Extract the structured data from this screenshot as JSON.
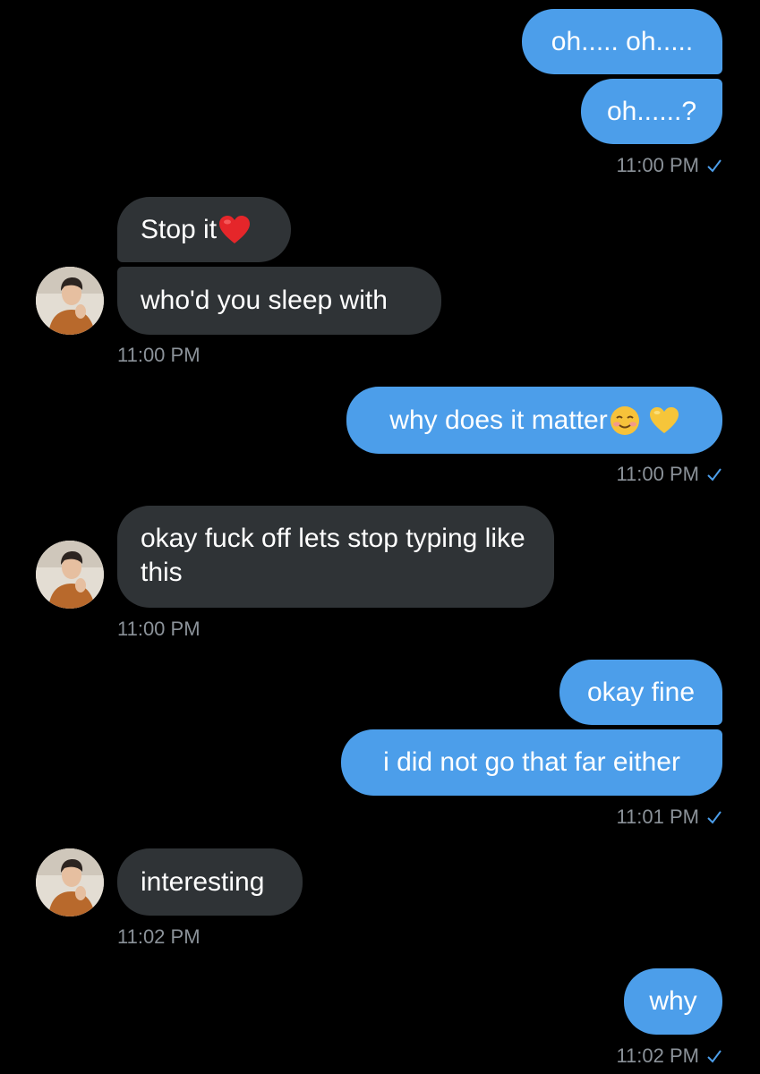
{
  "messages": [
    {
      "side": "out",
      "text": "oh..... oh....."
    },
    {
      "side": "out",
      "text": "oh......?"
    },
    {
      "side": "out",
      "time": "11:00 PM"
    },
    {
      "side": "in",
      "text": "Stop it",
      "emoji": "red-heart-emoji"
    },
    {
      "side": "in",
      "text": "who'd you sleep with"
    },
    {
      "side": "in",
      "time": "11:00 PM"
    },
    {
      "side": "out",
      "text": "why does it matter",
      "emoji": [
        "smiling-face-emoji",
        "yellow-heart-emoji"
      ]
    },
    {
      "side": "out",
      "time": "11:00 PM"
    },
    {
      "side": "in",
      "text": "okay fuck off lets stop typing like this"
    },
    {
      "side": "in",
      "time": "11:00 PM"
    },
    {
      "side": "out",
      "text": "okay fine"
    },
    {
      "side": "out",
      "text": "i did not go that far either"
    },
    {
      "side": "out",
      "time": "11:01 PM"
    },
    {
      "side": "in",
      "text": "interesting"
    },
    {
      "side": "in",
      "time": "11:02 PM"
    },
    {
      "side": "out",
      "text": "why"
    },
    {
      "side": "out",
      "time": "11:02 PM"
    }
  ],
  "colors": {
    "outgoing_bubble": "#4c9eea",
    "incoming_bubble": "#2f3336",
    "background": "#000000",
    "timestamp": "#8b9299",
    "read_check": "#4c9eea"
  },
  "icons": {
    "read_receipt": "checkmark-icon",
    "avatar": "contact-avatar"
  }
}
